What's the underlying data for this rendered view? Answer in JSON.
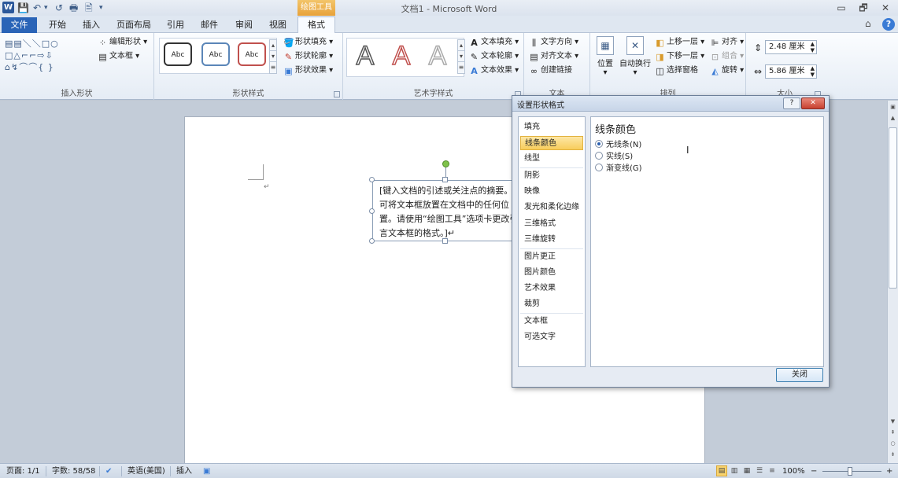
{
  "window": {
    "title": "文档1 - Microsoft Word",
    "app_icon": "W",
    "context_tab_label": "绘图工具",
    "minimize": "▭",
    "restore": "🗗",
    "close": "✕",
    "ribbon_min": "⌂",
    "help": "?"
  },
  "qat": {
    "save": "💾",
    "undo": "↶",
    "undo_dropdown": "▾",
    "redo": "↺",
    "print": "🖶",
    "print_preview": "🖹",
    "customize": "▾"
  },
  "tabs": [
    "文件",
    "开始",
    "插入",
    "页面布局",
    "引用",
    "邮件",
    "审阅",
    "视图",
    "格式"
  ],
  "ribbon": {
    "insert_shapes": {
      "label": "插入形状",
      "gallery_row1": "▤▤＼＼□○",
      "gallery_row2": "□△⌐⌐⇨⇩",
      "gallery_row3": "⌂↯⌒⌒{ }",
      "edit_shape": "编辑形状",
      "text_box": "文本框"
    },
    "shape_styles": {
      "label": "形状样式",
      "samples": [
        "Abc",
        "Abc",
        "Abc"
      ],
      "fill": "形状填充",
      "outline": "形状轮廓",
      "effects": "形状效果"
    },
    "wordart": {
      "label": "艺术字样式",
      "samples": [
        "A",
        "A",
        "A"
      ],
      "text_fill": "文本填充",
      "text_outline": "文本轮廓",
      "text_effects": "文本效果"
    },
    "text": {
      "label": "文本",
      "direction": "文字方向",
      "align": "对齐文本",
      "link": "创建链接"
    },
    "arrange": {
      "label": "排列",
      "position": "位置",
      "wrap": "自动换行",
      "bring_forward": "上移一层",
      "send_backward": "下移一层",
      "selection_pane": "选择窗格",
      "align": "对齐",
      "group": "组合",
      "rotate": "旋转"
    },
    "size": {
      "label": "大小",
      "height": "2.48 厘米",
      "width": "5.86 厘米"
    }
  },
  "document": {
    "para_mark": "↵",
    "textbox_text": "[键入文档的引述或关注点的摘要。您可将文本框放置在文档中的任何位置。请使用“绘图工具”选项卡更改引言文本框的格式。]↵"
  },
  "dialog": {
    "title": "设置形状格式",
    "help_btn": "?",
    "close_btn": "✕",
    "nav": [
      "填充",
      "线条颜色",
      "线型",
      "阴影",
      "映像",
      "发光和柔化边缘",
      "三维格式",
      "三维旋转",
      "图片更正",
      "图片颜色",
      "艺术效果",
      "裁剪",
      "文本框",
      "可选文字"
    ],
    "active_nav": "线条颜色",
    "heading": "线条颜色",
    "options": [
      "无线条(N)",
      "实线(S)",
      "渐变线(G)"
    ],
    "selected_option": "无线条(N)",
    "ok": "关闭"
  },
  "statusbar": {
    "page": "页面: 1/1",
    "words": "字数: 58/58",
    "language": "英语(美国)",
    "mode": "插入",
    "zoom": "100%",
    "zoom_out": "−",
    "zoom_in": "+"
  },
  "scrollbar": {
    "up": "▲",
    "down": "▼",
    "ruler": "▣",
    "prev": "⇞",
    "browse": "○",
    "next": "⇟"
  },
  "colors": {
    "file_tab": "#2a64b7",
    "active_nav": "#f8cd5c",
    "rotate_handle": "#7ec24a",
    "context_tab": "#e8a23a"
  }
}
